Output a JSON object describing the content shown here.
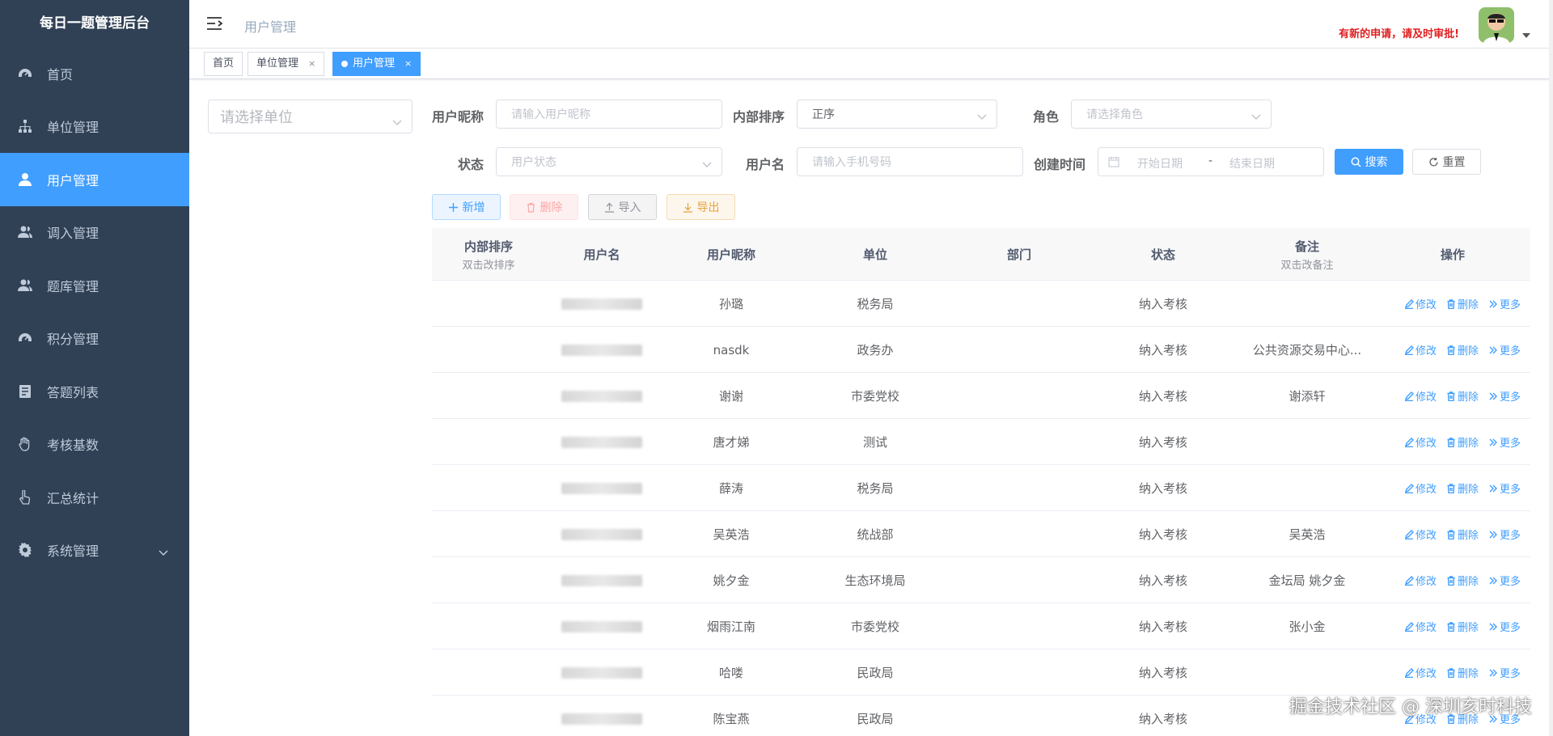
{
  "app": {
    "brand": "每日一题管理后台"
  },
  "sidebar": {
    "items": [
      {
        "label": "首页",
        "icon": "dashboard-icon"
      },
      {
        "label": "单位管理",
        "icon": "tree-icon"
      },
      {
        "label": "用户管理",
        "icon": "user-icon",
        "active": true
      },
      {
        "label": "调入管理",
        "icon": "peoples-icon"
      },
      {
        "label": "题库管理",
        "icon": "peoples-icon"
      },
      {
        "label": "积分管理",
        "icon": "dashboard-icon"
      },
      {
        "label": "答题列表",
        "icon": "list-icon"
      },
      {
        "label": "考核基数",
        "icon": "hand-icon"
      },
      {
        "label": "汇总统计",
        "icon": "pointer-icon"
      },
      {
        "label": "系统管理",
        "icon": "gear-icon",
        "expandable": true
      }
    ]
  },
  "header": {
    "title": "用户管理",
    "notice": "有新的申请，请及时审批!"
  },
  "tags": [
    {
      "label": "首页"
    },
    {
      "label": "单位管理"
    },
    {
      "label": "用户管理",
      "active": true
    }
  ],
  "unit_select": {
    "placeholder": "请选择单位"
  },
  "form": {
    "nickname_label": "用户昵称",
    "nickname_placeholder": "请输入用户昵称",
    "order_label": "内部排序",
    "order_value": "正序",
    "role_label": "角色",
    "role_placeholder": "请选择角色",
    "status_label": "状态",
    "status_placeholder": "用户状态",
    "username_label": "用户名",
    "username_placeholder": "请输入手机号码",
    "created_label": "创建时间",
    "start_placeholder": "开始日期",
    "range_sep": "-",
    "end_placeholder": "结束日期",
    "search_label": "搜索",
    "reset_label": "重置"
  },
  "toolbar": {
    "add": "新增",
    "delete": "删除",
    "import": "导入",
    "export": "导出"
  },
  "table": {
    "columns": [
      {
        "label": "内部排序",
        "sub": "双击改排序"
      },
      {
        "label": "用户名",
        "sub": ""
      },
      {
        "label": "用户昵称",
        "sub": ""
      },
      {
        "label": "单位",
        "sub": ""
      },
      {
        "label": "部门",
        "sub": ""
      },
      {
        "label": "状态",
        "sub": ""
      },
      {
        "label": "备注",
        "sub": "双击改备注"
      },
      {
        "label": "操作",
        "sub": ""
      }
    ],
    "rows": [
      {
        "nickname": "孙璐",
        "unit": "税务局",
        "status": "纳入考核",
        "remark": ""
      },
      {
        "nickname": "nasdk",
        "unit": "政务办",
        "status": "纳入考核",
        "remark": "公共资源交易中心..."
      },
      {
        "nickname": "谢谢",
        "unit": "市委党校",
        "status": "纳入考核",
        "remark": "谢添轩"
      },
      {
        "nickname": "唐才娣",
        "unit": "测试",
        "status": "纳入考核",
        "remark": ""
      },
      {
        "nickname": "薛涛",
        "unit": "税务局",
        "status": "纳入考核",
        "remark": ""
      },
      {
        "nickname": "吴英浩",
        "unit": "统战部",
        "status": "纳入考核",
        "remark": "吴英浩"
      },
      {
        "nickname": "姚夕金",
        "unit": "生态环境局",
        "status": "纳入考核",
        "remark": "金坛局 姚夕金"
      },
      {
        "nickname": "烟雨江南",
        "unit": "市委党校",
        "status": "纳入考核",
        "remark": "张小金"
      },
      {
        "nickname": "哈喽",
        "unit": "民政局",
        "status": "纳入考核",
        "remark": ""
      },
      {
        "nickname": "陈宝燕",
        "unit": "民政局",
        "status": "纳入考核",
        "remark": ""
      }
    ],
    "ops": {
      "edit": "修改",
      "delete": "删除",
      "more": "更多"
    }
  },
  "watermark": "掘金技术社区 @ 深圳亥时科技"
}
